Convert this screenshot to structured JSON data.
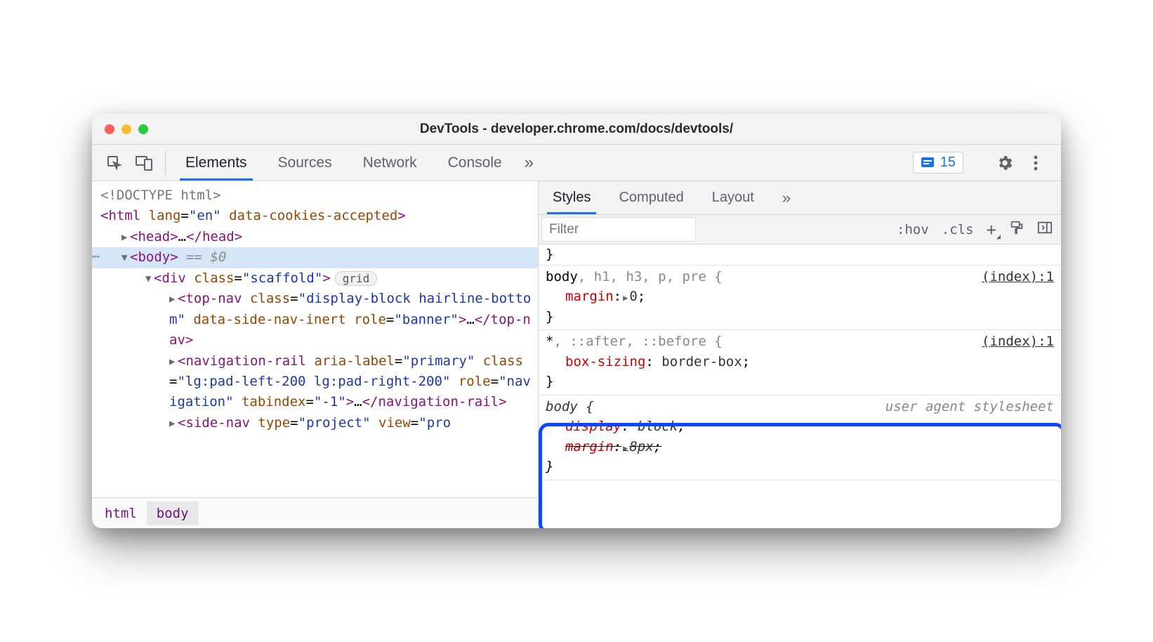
{
  "window_title": "DevTools - developer.chrome.com/docs/devtools/",
  "main_tabs": [
    "Elements",
    "Sources",
    "Network",
    "Console"
  ],
  "main_active_tab": "Elements",
  "issues_count": "15",
  "dom": {
    "doctype": "<!DOCTYPE html>",
    "html_open": "<html lang=\"en\" data-cookies-accepted>",
    "head": "<head>…</head>",
    "body_open": "<body>",
    "body_suffix": " == $0",
    "scaffold_open": "<div class=\"scaffold\">",
    "scaffold_badge": "grid",
    "topnav": "<top-nav class=\"display-block hairline-bottom\" data-side-nav-inert role=\"banner\">…</top-nav>",
    "navrail": "<navigation-rail aria-label=\"primary\" class=\"lg:pad-left-200 lg:pad-right-200\" role=\"navigation\" tabindex=\"-1\">…</navigation-rail>",
    "sidenav": "<side-nav type=\"project\" view=\"pro"
  },
  "breadcrumbs": [
    "html",
    "body"
  ],
  "styles_tabs": [
    "Styles",
    "Computed",
    "Layout"
  ],
  "styles_active_tab": "Styles",
  "filter_placeholder": "Filter",
  "filter_tools": {
    "hov": ":hov",
    "cls": ".cls"
  },
  "rules": {
    "r1": {
      "selector_matched": "body",
      "selector_rest": ", h1, h3, p, pre {",
      "source": "(index):1",
      "prop1_name": "margin",
      "prop1_value": "0"
    },
    "r2": {
      "selector_matched": "*",
      "selector_rest": ", ::after, ::before {",
      "source": "(index):1",
      "prop1_name": "box-sizing",
      "prop1_value": "border-box"
    },
    "r3": {
      "selector": "body {",
      "source": "user agent stylesheet",
      "prop1_name": "display",
      "prop1_value": "block",
      "prop2_name": "margin",
      "prop2_value": "8px"
    }
  }
}
